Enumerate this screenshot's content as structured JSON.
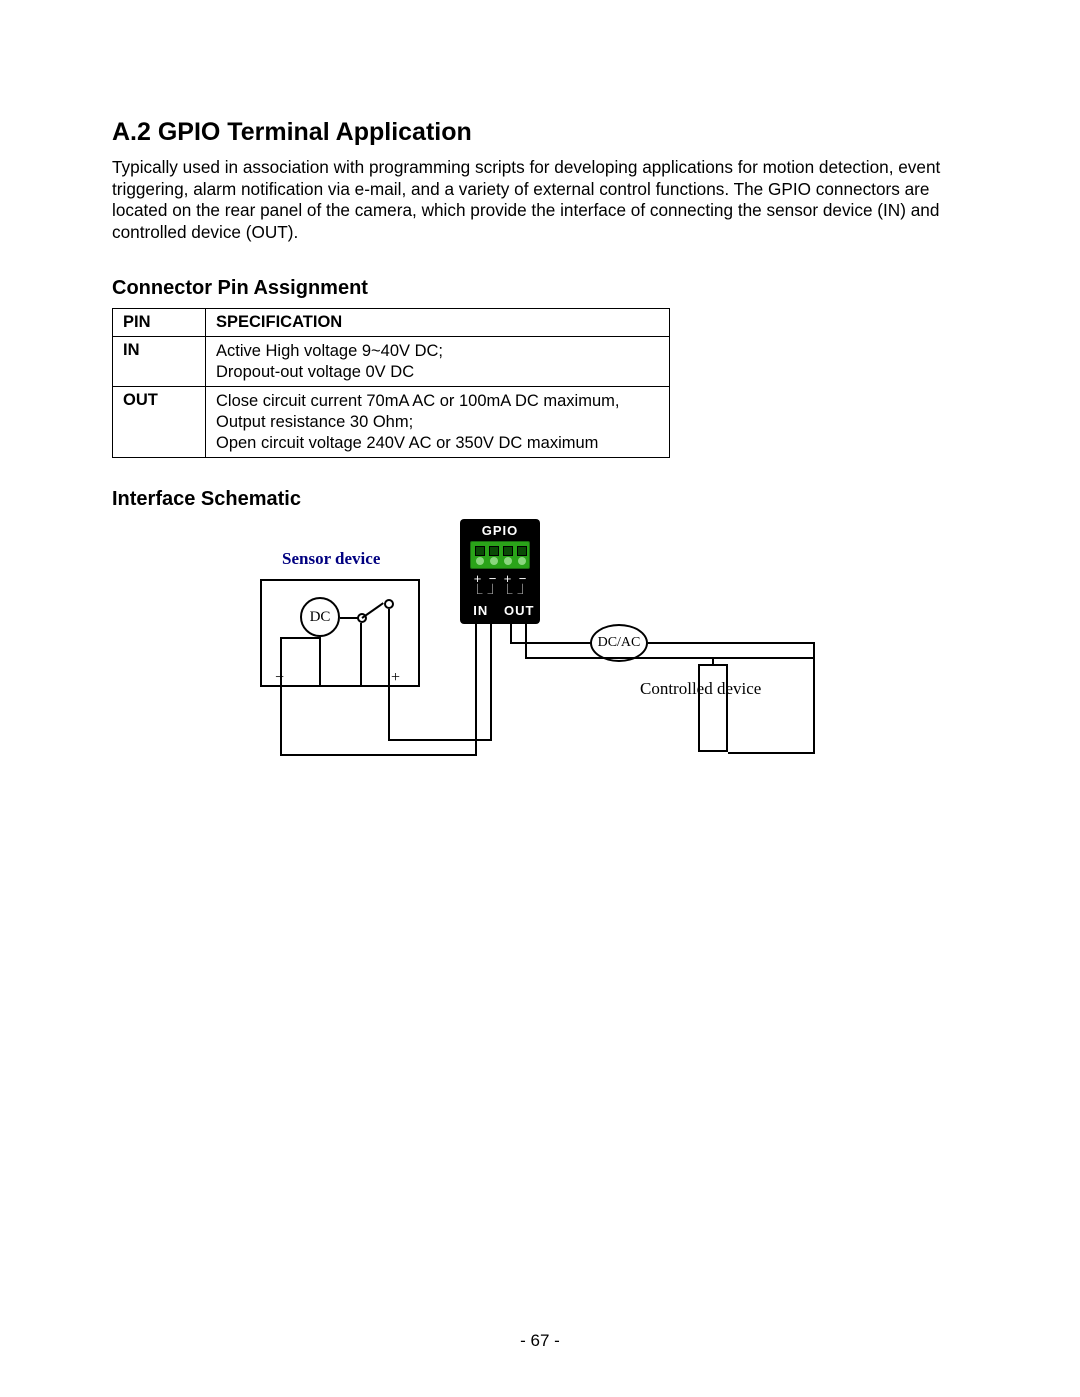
{
  "heading": "A.2 GPIO Terminal Application",
  "intro": "Typically used in association with programming scripts for developing applications for motion detection, event triggering, alarm notification via e-mail, and a variety of external control functions. The GPIO connectors are located on the rear panel of the camera, which provide the interface of connecting the sensor device (IN) and controlled device (OUT).",
  "section_pin_heading": "Connector Pin Assignment",
  "table": {
    "header_pin": "PIN",
    "header_spec": "SPECIFICATION",
    "rows": [
      {
        "pin": "IN",
        "spec_lines": [
          "Active High voltage 9~40V DC;",
          "Dropout-out voltage  0V DC"
        ]
      },
      {
        "pin": "OUT",
        "spec_lines": [
          "Close circuit current 70mA AC or 100mA DC maximum, Output resistance 30 Ohm;",
          "Open circuit voltage 240V AC or 350V DC maximum"
        ]
      }
    ]
  },
  "section_schematic_heading": "Interface Schematic",
  "schematic": {
    "sensor_label": "Sensor device",
    "gpio_label": "GPIO",
    "gpio_in": "IN",
    "gpio_out": "OUT",
    "dc_label": "DC",
    "dcac_label": "DC/AC",
    "controlled_label": "Controlled device",
    "plus": "+",
    "minus": "−",
    "bracket_l": "⎿",
    "bracket_r": "⏌"
  },
  "page_number": "- 67 -"
}
